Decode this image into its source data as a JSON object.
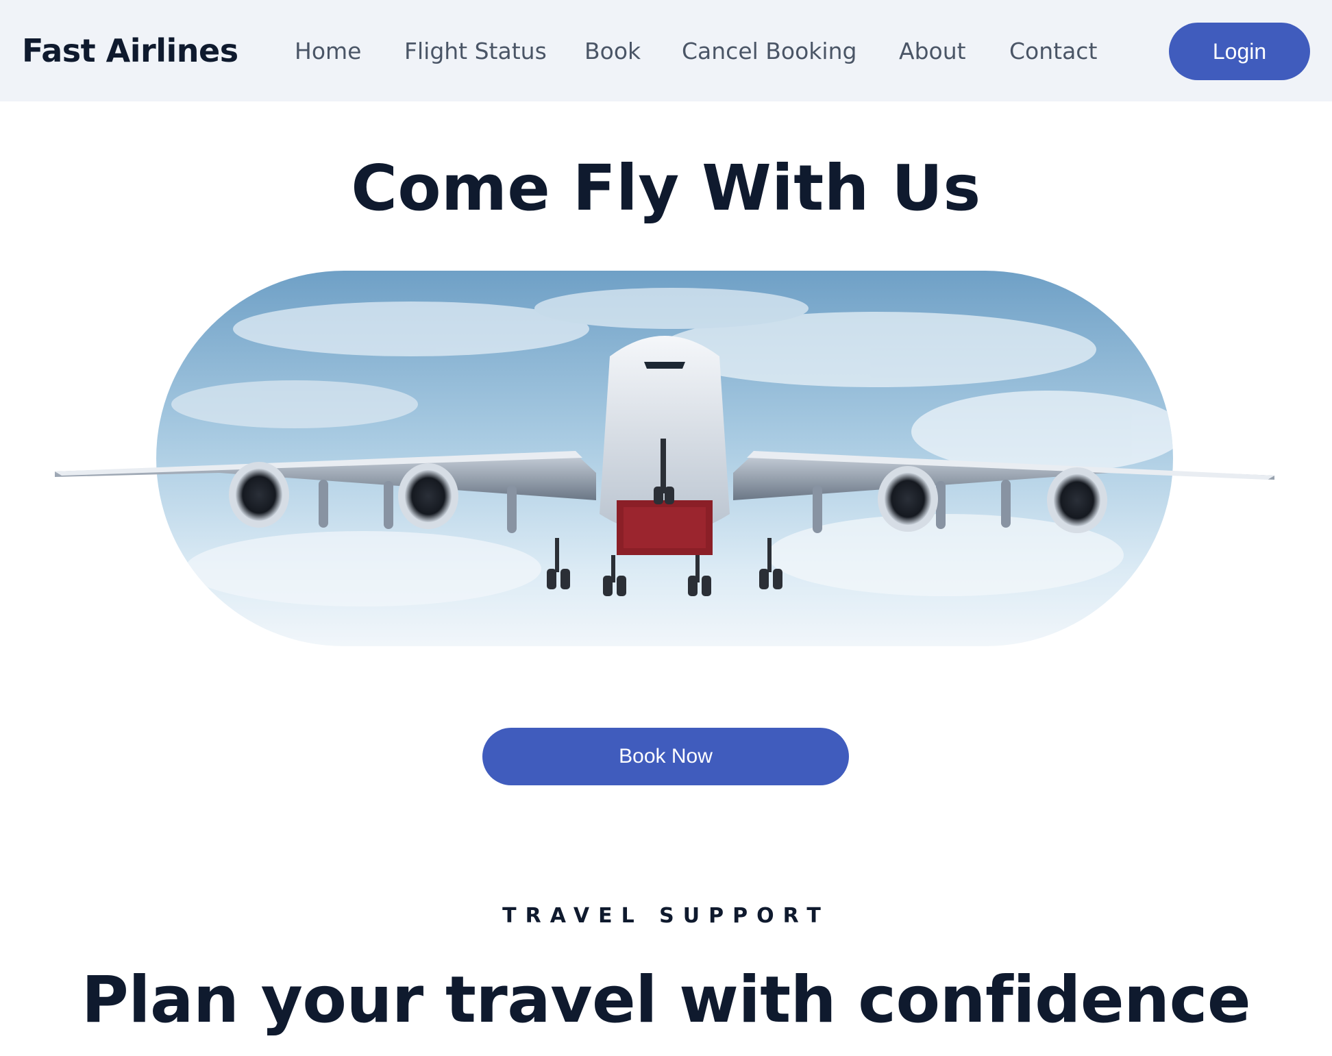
{
  "nav": {
    "brand": "Fast Airlines",
    "links": [
      "Home",
      "Flight Status",
      "Book",
      "Cancel Booking",
      "About",
      "Contact"
    ],
    "login_label": "Login"
  },
  "hero": {
    "title": "Come Fly With Us",
    "image_icon": "airplane-photo",
    "cta_label": "Book Now"
  },
  "support": {
    "eyebrow": "TRAVEL SUPPORT",
    "title": "Plan your travel with confidence"
  },
  "colors": {
    "accent": "#405cbd",
    "nav_background": "#f0f3f8",
    "heading": "#0f1a2e",
    "nav_text": "#4a5566"
  }
}
